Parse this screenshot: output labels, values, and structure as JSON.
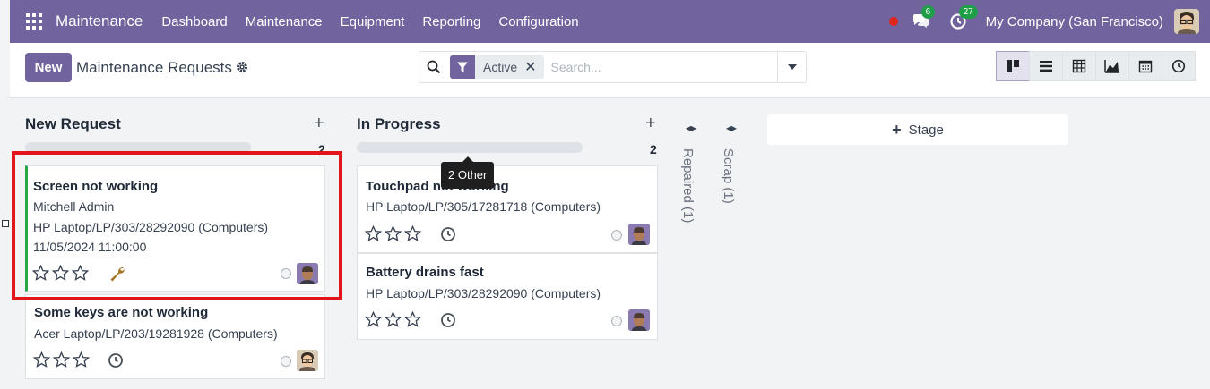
{
  "navbar": {
    "brand": "Maintenance",
    "menu": [
      "Dashboard",
      "Maintenance",
      "Equipment",
      "Reporting",
      "Configuration"
    ],
    "messages_count": "6",
    "activities_count": "27",
    "company": "My Company (San Francisco)"
  },
  "control_panel": {
    "new_label": "New",
    "title": "Maintenance Requests",
    "facet_label": "Active",
    "search_placeholder": "Search..."
  },
  "columns": [
    {
      "title": "New Request",
      "count": "2",
      "cards": [
        {
          "title": "Screen not working",
          "lines": [
            "Mitchell Admin",
            "HP Laptop/LP/303/28292090 (Computers)",
            "11/05/2024 11:00:00"
          ],
          "icon": "wrench-icon"
        },
        {
          "title": "Some keys are not working",
          "lines": [
            "Acer Laptop/LP/203/19281928 (Computers)"
          ],
          "icon": "clock-icon"
        }
      ]
    },
    {
      "title": "In Progress",
      "count": "2",
      "cards": [
        {
          "title": "Touchpad not working",
          "lines": [
            "HP Laptop/LP/305/17281718 (Computers)"
          ],
          "icon": "clock-icon"
        },
        {
          "title": "Battery drains fast",
          "lines": [
            "HP Laptop/LP/303/28292090 (Computers)"
          ],
          "icon": "clock-icon"
        }
      ]
    }
  ],
  "folded_columns": [
    "Repaired (1)",
    "Scrap (1)"
  ],
  "add_stage_label": "Stage",
  "tooltip": "2 Other",
  "colors": {
    "brand": "#71639e",
    "card_accent": "#28a745",
    "highlight": "#e3151a",
    "wrench": "#a5731e"
  }
}
